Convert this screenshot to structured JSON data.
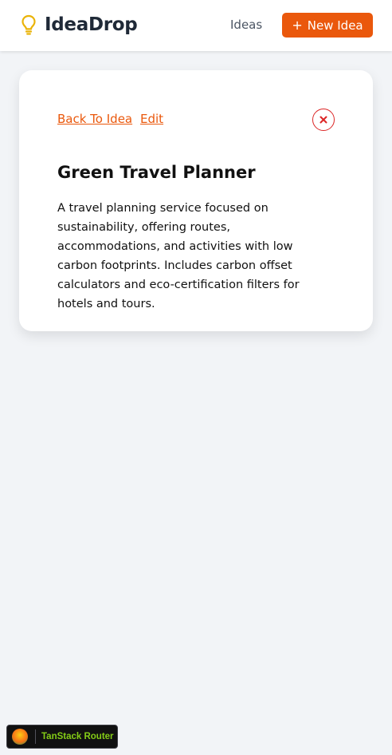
{
  "header": {
    "brand_name": "IdeaDrop",
    "brand_icon": "lightbulb-icon",
    "nav_ideas_label": "Ideas",
    "new_idea_plus": "+",
    "new_idea_label": "New Idea"
  },
  "idea": {
    "back_link_label": "Back To Idea",
    "edit_link_label": "Edit",
    "delete_icon": "close-icon",
    "title": "Green Travel Planner",
    "description": "A travel planning service focused on sustainability, offering routes, accommodations, and activities with low carbon footprints. Includes carbon offset calculators and eco-certification filters for hotels and tours."
  },
  "devtools": {
    "label": "TanStack Router",
    "logo_icon": "tanstack-logo-icon"
  },
  "colors": {
    "accent": "#ea580c",
    "brand_icon": "#eab308",
    "danger": "#dc2626",
    "page_background": "#f2f4f7",
    "card_background": "#ffffff"
  }
}
